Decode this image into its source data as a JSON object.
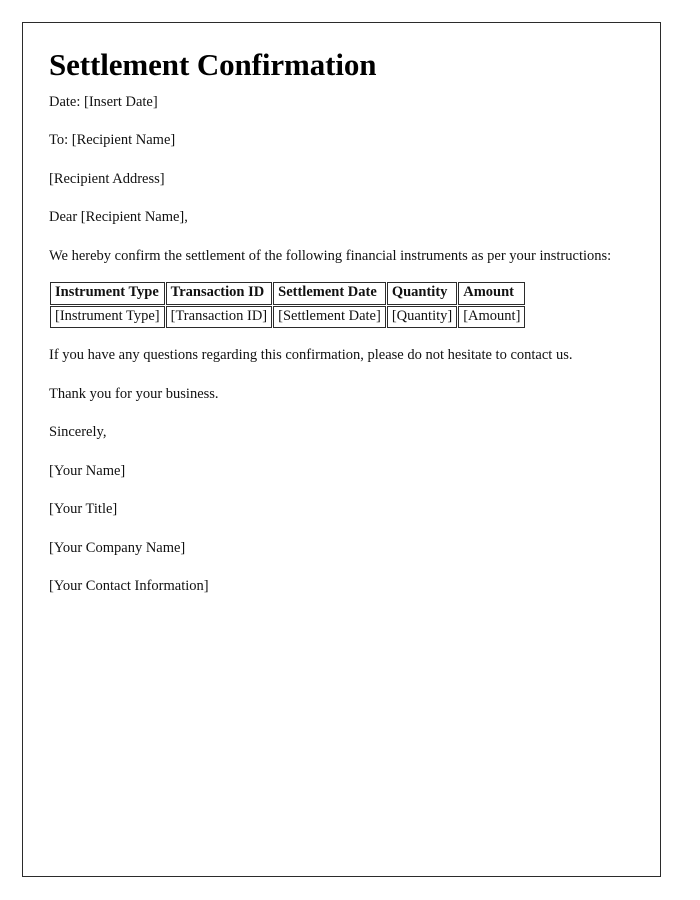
{
  "document": {
    "title": "Settlement Confirmation",
    "date_line": "Date: [Insert Date]",
    "to_line": "To: [Recipient Name]",
    "address_line": "[Recipient Address]",
    "salutation": "Dear [Recipient Name],",
    "intro_paragraph": "We hereby confirm the settlement of the following financial instruments as per your instructions:",
    "questions_paragraph": "If you have any questions regarding this confirmation, please do not hesitate to contact us.",
    "thanks_paragraph": "Thank you for your business.",
    "closing": "Sincerely,",
    "signature": {
      "name": "[Your Name]",
      "title": "[Your Title]",
      "company": "[Your Company Name]",
      "contact": "[Your Contact Information]"
    }
  },
  "table": {
    "headers": [
      "Instrument Type",
      "Transaction ID",
      "Settlement Date",
      "Quantity",
      "Amount"
    ],
    "rows": [
      [
        "[Instrument Type]",
        "[Transaction ID]",
        "[Settlement Date]",
        "[Quantity]",
        "[Amount]"
      ]
    ]
  },
  "colors": {
    "text": "#111111",
    "border": "#2b2b2b",
    "background": "#ffffff"
  }
}
